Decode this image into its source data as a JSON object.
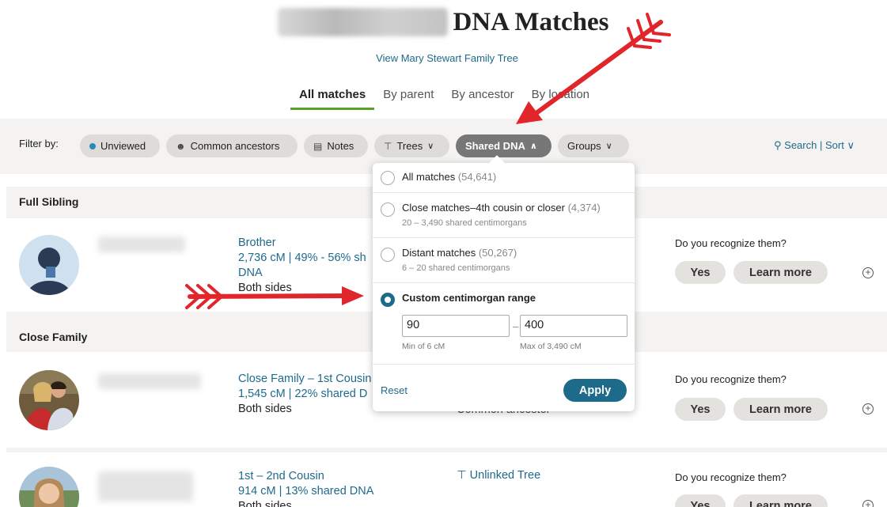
{
  "header": {
    "title_suffix": "DNA Matches",
    "tree_link": "View Mary Stewart Family Tree"
  },
  "tabs": [
    "All matches",
    "By parent",
    "By ancestor",
    "By location"
  ],
  "filter": {
    "label": "Filter by:",
    "pills": {
      "unviewed": "Unviewed",
      "common_ancestors": "Common ancestors",
      "notes": "Notes",
      "trees": "Trees",
      "shared_dna": "Shared DNA",
      "groups": "Groups"
    },
    "search": "Search",
    "separator": "|",
    "sort": "Sort"
  },
  "sections": {
    "full_sibling": "Full Sibling",
    "close_family": "Close Family"
  },
  "matches": [
    {
      "relationship": "Brother",
      "shared": "2,736 cM | 49% - 56% sh",
      "shared_line2": "DNA",
      "sides": "Both sides",
      "recognize": "Do you recognize them?",
      "yes": "Yes",
      "learn_more": "Learn more"
    },
    {
      "relationship": "Close Family – 1st Cousin",
      "shared": "1,545 cM | 22% shared D",
      "sides": "Both sides",
      "middle": "Common ancestor",
      "recognize": "Do you recognize them?",
      "yes": "Yes",
      "learn_more": "Learn more"
    },
    {
      "relationship": "1st – 2nd Cousin",
      "shared": "914 cM | 13% shared DNA",
      "sides": "Both sides",
      "middle": "Unlinked Tree",
      "recognize": "Do you recognize them?",
      "yes": "Yes",
      "learn_more": "Learn more"
    }
  ],
  "dropdown": {
    "options": [
      {
        "title": "All matches",
        "count": "(54,641)",
        "sub": ""
      },
      {
        "title": "Close matches–4th cousin or closer",
        "count": "(4,374)",
        "sub": "20 – 3,490 shared centimorgans"
      },
      {
        "title": "Distant matches",
        "count": "(50,267)",
        "sub": "6 – 20 shared centimorgans"
      },
      {
        "title": "Custom centimorgan range",
        "count": "",
        "sub": ""
      }
    ],
    "min_value": "90",
    "max_value": "400",
    "dash": "–",
    "min_hint": "Min of 6 cM",
    "max_hint": "Max of 3,490 cM",
    "reset": "Reset",
    "apply": "Apply"
  },
  "colors": {
    "link": "#1d6a8b",
    "active_tab_underline": "#5aa22d",
    "annotation_arrow": "#e0252b"
  }
}
